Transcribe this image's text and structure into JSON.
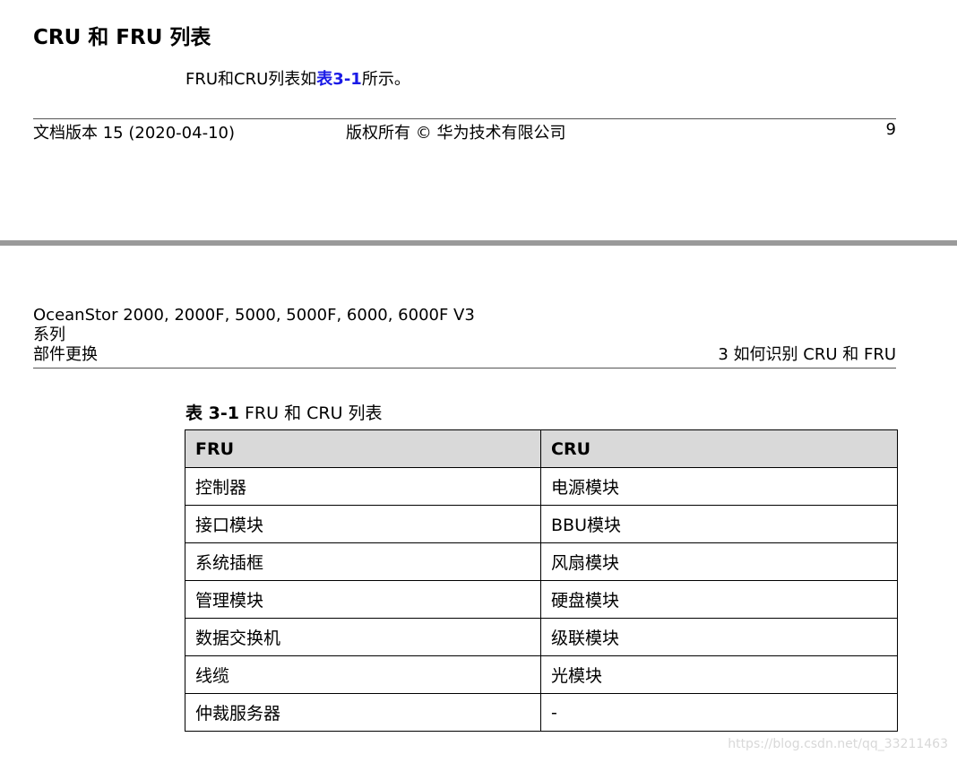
{
  "section": {
    "title": "CRU 和 FRU 列表",
    "intro_prefix": "FRU和CRU列表如",
    "intro_ref": "表3-1",
    "intro_suffix": "所示。"
  },
  "footer": {
    "doc_version": "文档版本 15 (2020-04-10)",
    "copyright": "版权所有 © 华为技术有限公司",
    "page_number": "9"
  },
  "header": {
    "product_line1": "OceanStor 2000, 2000F, 5000, 5000F, 6000, 6000F V3",
    "product_line2": "系列",
    "manual": "部件更换",
    "chapter": "3 如何识别 CRU 和 FRU"
  },
  "table": {
    "caption_label": "表 3-1",
    "caption_text": " FRU 和 CRU 列表",
    "columns": [
      "FRU",
      "CRU"
    ],
    "rows": [
      [
        "控制器",
        "电源模块"
      ],
      [
        "接口模块",
        "BBU模块"
      ],
      [
        "系统插框",
        "风扇模块"
      ],
      [
        "管理模块",
        "硬盘模块"
      ],
      [
        "数据交换机",
        "级联模块"
      ],
      [
        "线缆",
        "光模块"
      ],
      [
        "仲裁服务器",
        "-"
      ]
    ]
  },
  "watermark": "https://blog.csdn.net/qq_33211463"
}
